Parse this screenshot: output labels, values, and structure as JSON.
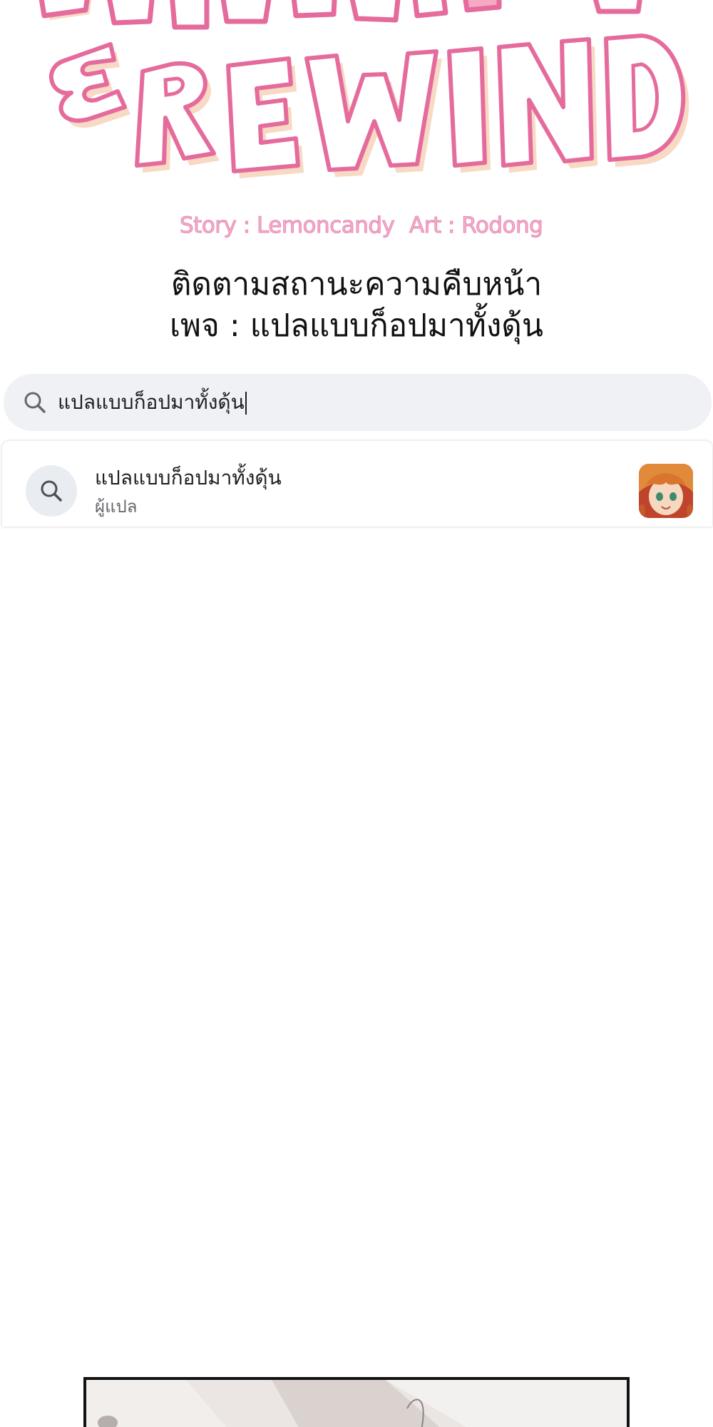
{
  "title_art": {
    "logo_text": "& REWIND",
    "colors": {
      "fill": "#ffffff",
      "outline": "#e56b9d",
      "shadow": "#f7d9c4"
    }
  },
  "credits": {
    "story": "Story : Lemoncandy",
    "art": "Art : Rodong",
    "color": "#f4aecb"
  },
  "notice": {
    "line1": "ติดตามสถานะความคืบหน้า",
    "line2": "เพจ : แปลแบบก็อปมาทั้งดุ้น"
  },
  "search": {
    "value": "แปลแบบก็อปมาทั้งดุ้น",
    "icon": "search-icon"
  },
  "results": [
    {
      "title": "แปลแบบก็อปมาทั้งดุ้น",
      "subtitle": "ผู้แปล",
      "icon": "search-icon",
      "avatar": "avatar-icon"
    }
  ]
}
